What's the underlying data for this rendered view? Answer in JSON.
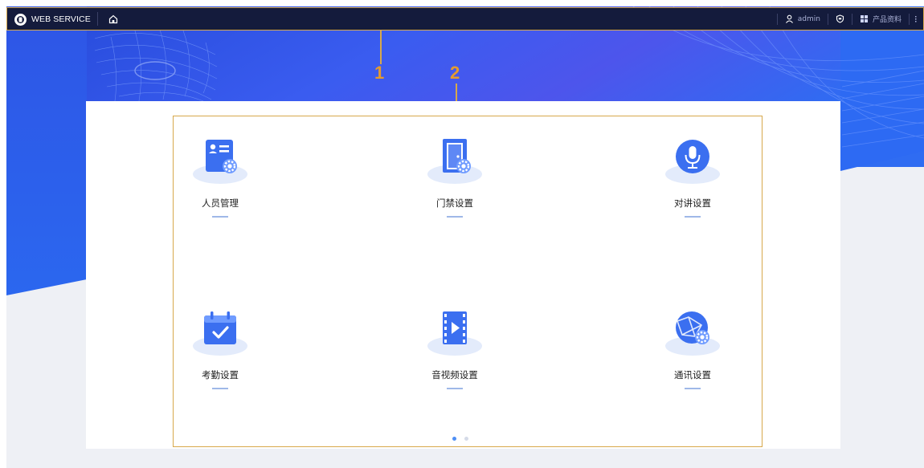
{
  "header": {
    "app_title": "WEB SERVICE",
    "user_name": "admin",
    "product_info_label": "产品资料"
  },
  "annotations": {
    "callout_1": "1",
    "callout_2": "2"
  },
  "menu": {
    "tiles": [
      {
        "label": "人员管理",
        "icon": "person-card-settings-icon"
      },
      {
        "label": "门禁设置",
        "icon": "door-settings-icon"
      },
      {
        "label": "对讲设置",
        "icon": "microphone-icon"
      },
      {
        "label": "考勤设置",
        "icon": "calendar-check-icon"
      },
      {
        "label": "音视频设置",
        "icon": "video-film-icon"
      },
      {
        "label": "通讯设置",
        "icon": "globe-settings-icon"
      }
    ],
    "pagination": {
      "pages": 2,
      "current": 1
    }
  },
  "colors": {
    "topbar": "#141b3c",
    "accent_blue": "#3b6ff0",
    "annotation_orange": "#d7a84b",
    "background": "#eef0f5"
  }
}
